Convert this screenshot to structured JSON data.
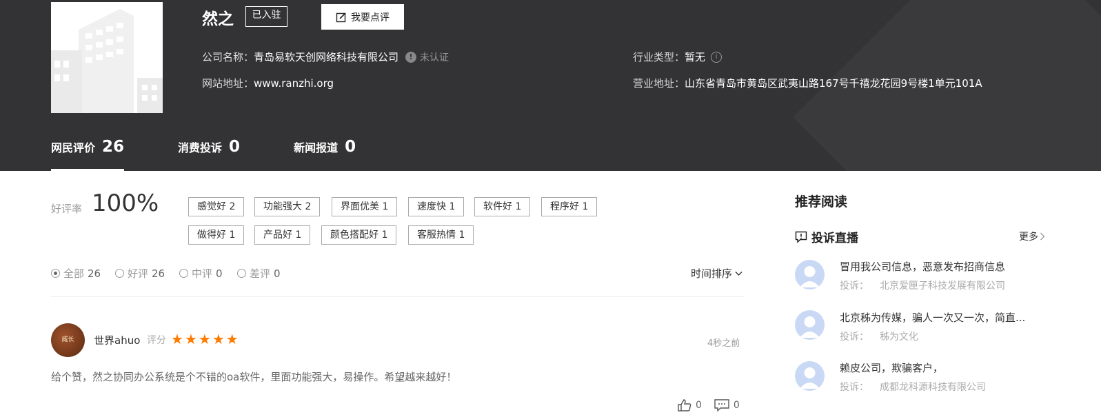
{
  "company": {
    "name": "然之",
    "settled_badge": "已入驻",
    "review_button": "我要点评",
    "company_name_label": "公司名称：",
    "company_name_value": "青岛易软天创网络科技有限公司",
    "unverified": "未认证",
    "website_label": "网站地址：",
    "website_value": "www.ranzhi.org",
    "industry_label": "行业类型：",
    "industry_value": "暂无",
    "address_label": "营业地址：",
    "address_value": "山东省青岛市黄岛区武夷山路167号千禧龙花园9号楼1单元101A"
  },
  "tabs": [
    {
      "label": "网民评价",
      "count": "26"
    },
    {
      "label": "消费投诉",
      "count": "0"
    },
    {
      "label": "新闻报道",
      "count": "0"
    }
  ],
  "rating": {
    "label": "好评率",
    "value": "100%"
  },
  "tags": [
    "感觉好 2",
    "功能强大 2",
    "界面优美 1",
    "速度快 1",
    "软件好 1",
    "程序好 1",
    "做得好 1",
    "产品好 1",
    "颜色搭配好 1",
    "客服热情 1"
  ],
  "filters": [
    {
      "label": "全部",
      "count": "26"
    },
    {
      "label": "好评",
      "count": "26"
    },
    {
      "label": "中评",
      "count": "0"
    },
    {
      "label": "差评",
      "count": "0"
    }
  ],
  "sort_label": "时间排序",
  "review": {
    "avatar_text": "威长",
    "username": "世界ahuo",
    "score_label": "评分",
    "stars": 5,
    "time": "4秒之前",
    "comment": "给个赞，然之协同办公系统是个不错的oa软件，里面功能强大，易操作。希望越来越好！",
    "likes": "0",
    "replies": "0"
  },
  "sidebar": {
    "title": "推荐阅读",
    "section_title": "投诉直播",
    "more": "更多",
    "complaint_label": "投诉：",
    "items": [
      {
        "title": "冒用我公司信息，恶意发布招商信息",
        "company": "北京爱匣子科技发展有限公司"
      },
      {
        "title": "北京秭为传媒，骗人一次又一次，简直...",
        "company": "秭为文化"
      },
      {
        "title": "赖皮公司，欺骗客户，",
        "company": "成都龙科源科技有限公司"
      }
    ]
  },
  "colors": {
    "header_bg": "#333335",
    "star": "#ff7a00"
  }
}
